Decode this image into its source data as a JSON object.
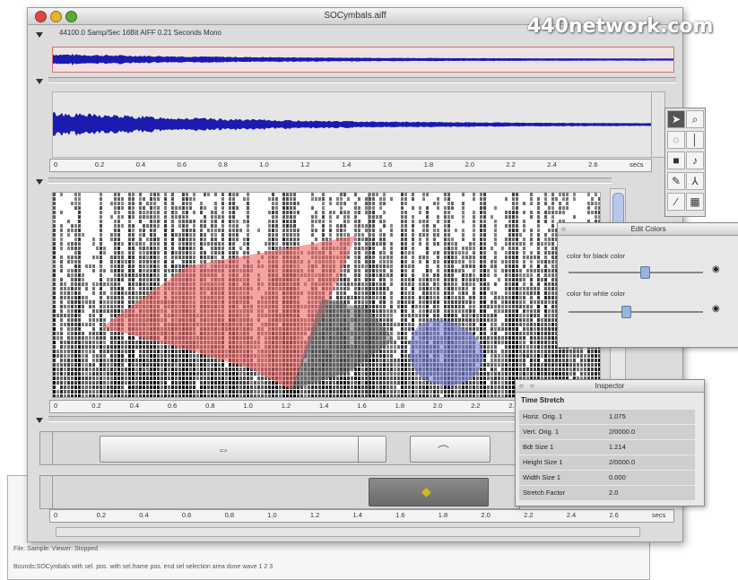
{
  "window": {
    "title": "SOCymbals.aiff",
    "traffic_lights": {
      "close": "#e0493f",
      "minimize": "#e8b232",
      "zoom": "#5aaa3a"
    }
  },
  "watermark": "440network.com",
  "selection_info": "44100.0 Samp/Sec   16Bit AIFF   0.21 Seconds   Mono",
  "ruler": {
    "labels": [
      "0",
      "0.2",
      "0.4",
      "0.6",
      "0.8",
      "1.0",
      "1.2",
      "1.4",
      "1.6",
      "1.8",
      "2.0",
      "2.2",
      "2.4",
      "2.6",
      "secs"
    ]
  },
  "tools": [
    {
      "icon": "arrow-icon",
      "glyph": "➤",
      "selected": true
    },
    {
      "icon": "magnifier-icon",
      "glyph": "⌕",
      "selected": false
    },
    {
      "icon": "lasso-icon",
      "glyph": "◌",
      "selected": false
    },
    {
      "icon": "time-cursor-icon",
      "glyph": "│",
      "selected": false
    },
    {
      "icon": "color-swatch-icon",
      "glyph": "■",
      "selected": false
    },
    {
      "icon": "dropper-icon",
      "glyph": "♪",
      "selected": false
    },
    {
      "icon": "paint-brush-icon",
      "glyph": "✎",
      "selected": false
    },
    {
      "icon": "compass-icon",
      "glyph": "⅄",
      "selected": false
    },
    {
      "icon": "pencil-icon",
      "glyph": "∕",
      "selected": false
    },
    {
      "icon": "grid-icon",
      "glyph": "▦",
      "selected": false
    }
  ],
  "edit_colors": {
    "title": "Edit Colors",
    "black_label": "color for black color",
    "white_label": "color for white color",
    "black_level": 0.56,
    "white_level": 0.42
  },
  "inspector": {
    "title": "Inspector",
    "section": "Time Stretch",
    "rows": [
      {
        "label": "Horiz. Orig. 1",
        "value": "1.075"
      },
      {
        "label": "Vert. Orig. 1",
        "value": "2/0000.0"
      },
      {
        "label": "Bdt Size 1",
        "value": "1.214"
      },
      {
        "label": "Height Size 1",
        "value": "2/0000.0"
      },
      {
        "label": "Width Size 1",
        "value": "0.000"
      },
      {
        "label": "Stretch Factor",
        "value": "2.0"
      }
    ]
  },
  "log": {
    "status": "File: Sample:  Viewer:  Stopped",
    "line": "Bounds:SOCymbals  with sel. pos. with sel.frame  pos. end sel  selection  area  done  wave  1  2  3"
  },
  "colors": {
    "wave": "#1b1bb0",
    "region_red": "#f06a6a",
    "region_blue": "#7b80d0",
    "region_gray": "#777777"
  }
}
